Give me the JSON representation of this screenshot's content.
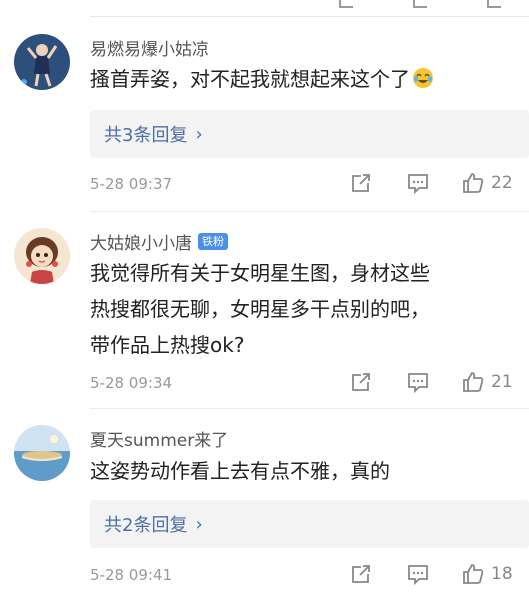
{
  "comments": [
    {
      "author": "易燃易爆小姑凉",
      "badge": "",
      "lines": [
        "搔首弄姿，对不起我就想起来这个了"
      ],
      "emoji": "laughing-crying-emoji",
      "replies_label": "共3条回复",
      "time": "5-28 09:37",
      "likes": "22"
    },
    {
      "author": "大姑娘小小唐",
      "badge": "铁粉",
      "lines": [
        "我觉得所有关于女明星生图，身材这些",
        "热搜都很无聊，女明星多干点别的吧，",
        "带作品上热搜ok?"
      ],
      "time": "5-28 09:34",
      "likes": "21"
    },
    {
      "author": "夏天summer来了",
      "badge": "",
      "lines": [
        "这姿势动作看上去有点不雅，真的"
      ],
      "replies_label": "共2条回复",
      "time": "5-28 09:41",
      "likes": "18"
    }
  ],
  "icons": {
    "repost": "repost-icon",
    "comment": "comment-icon",
    "like": "thumbs-up-icon",
    "reply_chevron": "chevron-right-icon"
  }
}
